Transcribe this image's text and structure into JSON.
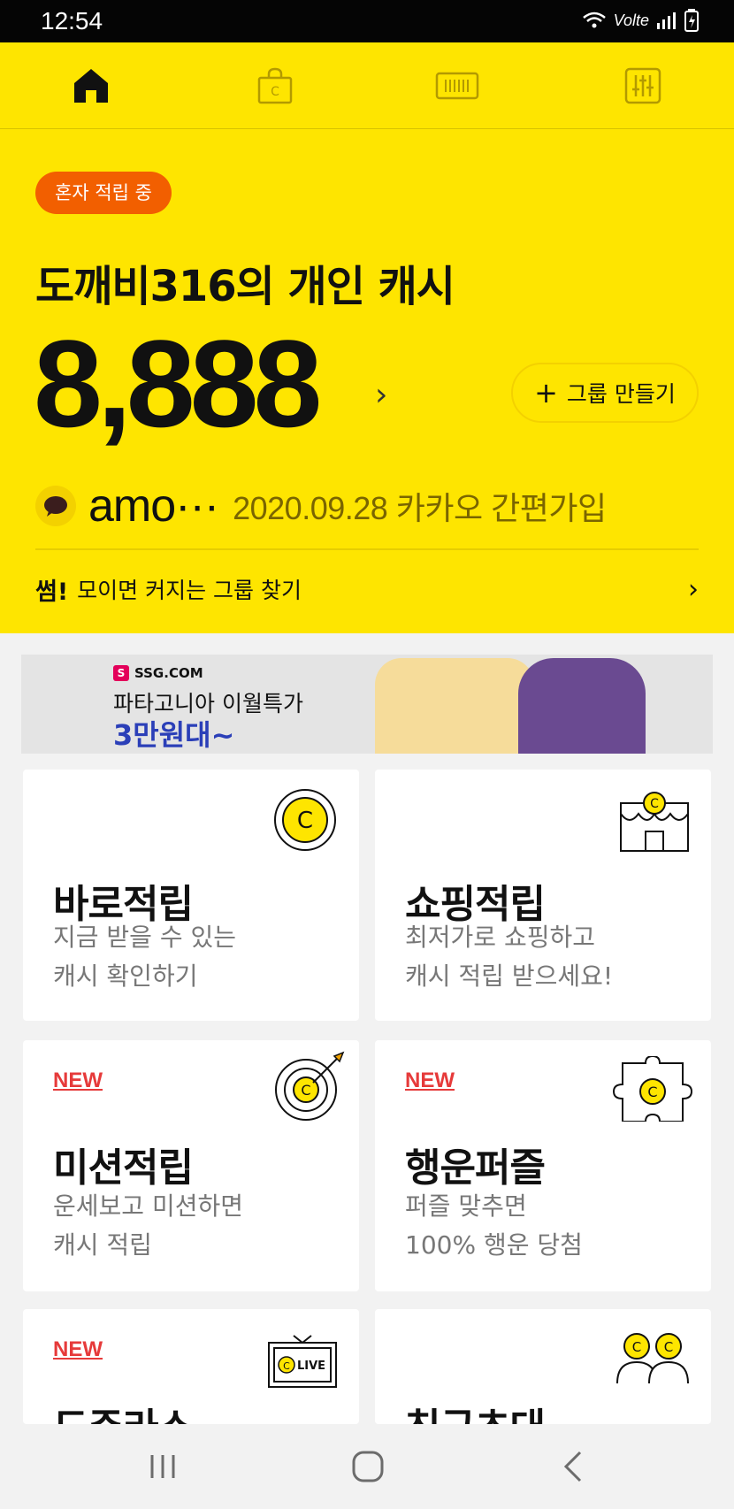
{
  "status_bar": {
    "time": "12:54",
    "network": "Volte"
  },
  "tabs": [
    "home-tab",
    "shop-tab",
    "barcode-tab",
    "settings-tab"
  ],
  "badge": "혼자 적립 중",
  "title": "도깨비316의 개인 캐시",
  "cash_amount": "8,888",
  "group_button": "그룹 만들기",
  "user": {
    "name": "amo···",
    "joined": "2020.09.28 카카오 간편가입"
  },
  "find_group": {
    "prefix": "썸!",
    "text": "모이면 커지는 그룹 찾기"
  },
  "banner": {
    "brand": "SSG.COM",
    "line1": "파타고니아 이월특가",
    "line2": "3만원대~"
  },
  "cards": [
    {
      "title": "바로적립",
      "desc1": "지금 받을 수 있는",
      "desc2": "캐시 확인하기",
      "is_new": false
    },
    {
      "title": "쇼핑적립",
      "desc1": "최저가로 쇼핑하고",
      "desc2": "캐시 적립 받으세요!",
      "is_new": false
    },
    {
      "title": "미션적립",
      "desc1": "운세보고 미션하면",
      "desc2": "캐시 적립",
      "is_new": true
    },
    {
      "title": "행운퍼즐",
      "desc1": "퍼즐 맞추면",
      "desc2": "100% 행운 당첨",
      "is_new": true
    },
    {
      "title": "도주라쇼",
      "desc1": "",
      "desc2": "",
      "is_new": true
    },
    {
      "title": "친구초대",
      "desc1": "",
      "desc2": "",
      "is_new": false
    }
  ],
  "new_label": "NEW",
  "live_label": "LIVE",
  "coin_letter": "C",
  "colors": {
    "brand_yellow": "#fee500",
    "badge_orange": "#f25f00",
    "new_red": "#e63a3a",
    "banner_blue": "#2b3fb8"
  }
}
